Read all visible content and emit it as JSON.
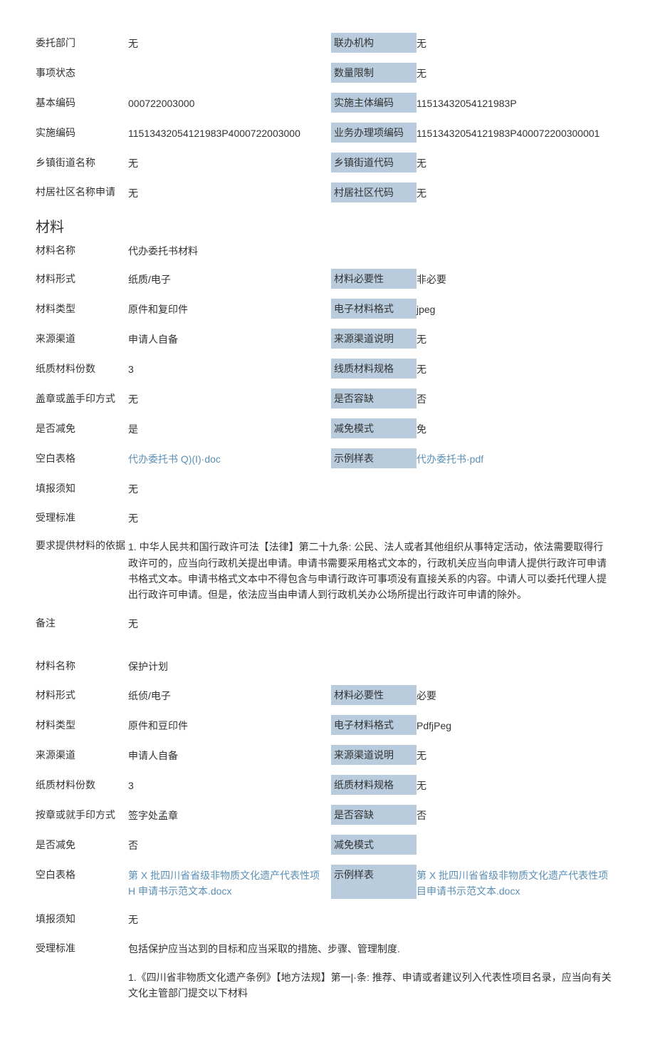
{
  "top": {
    "r1": {
      "l1": "委托部门",
      "v1": "无",
      "l2": "联办机构",
      "v2": "无"
    },
    "r2": {
      "l1": "事项状态",
      "v1": "",
      "l2": "数量限制",
      "v2": "无"
    },
    "r3": {
      "l1": "基本编码",
      "v1": "000722003000",
      "l2": "实施主体编码",
      "v2": "11513432054121983P"
    },
    "r4": {
      "l1": "实施编码",
      "v1": "11513432054121983P4000722003000",
      "l2": "业务办理项编码",
      "v2": "11513432054121983P400072200300001"
    },
    "r5": {
      "l1": "乡镇街道名称",
      "v1": "无",
      "l2": "乡镇街道代码",
      "v2": "无"
    },
    "r6": {
      "l1": "村居社区名称申请",
      "v1": "无",
      "l2": "村居社区代码",
      "v2": "无"
    }
  },
  "section_title": "材料",
  "m1": {
    "name": {
      "label": "材料名称",
      "value": "代办委托书材料"
    },
    "r1": {
      "l1": "材料形式",
      "v1": "纸质/电子",
      "l2": "材料必要性",
      "v2": "非必要"
    },
    "r2": {
      "l1": "材料类型",
      "v1": "原件和复印件",
      "l2": "电子材料格式",
      "v2": "jpeg"
    },
    "r3": {
      "l1": "来源渠道",
      "v1": "申请人自备",
      "l2": "来源渠道说明",
      "v2": "无"
    },
    "r4": {
      "l1": "纸质材料份数",
      "v1": "3",
      "l2": "线质材料规格",
      "v2": "无"
    },
    "r5": {
      "l1": "盖章或盖手印方式",
      "v1": "无",
      "l2": "是否容缺",
      "v2": "否"
    },
    "r6": {
      "l1": "是否减免",
      "v1": "是",
      "l2": "减免模式",
      "v2": "免"
    },
    "r7": {
      "l1": "空白表格",
      "v1": "代办委托书 Q)(I)·doc",
      "l2": "示例样表",
      "v2": "代办委托书·pdf"
    },
    "r8": {
      "l1": "填报须知",
      "v1": "无"
    },
    "r9": {
      "l1": "受理标准",
      "v1": "无"
    },
    "r10": {
      "l1": "要求提供材料的依据",
      "v1": "1. 中华人民共和国行政许可法【法律】第二十九条: 公民、法人或者其他组织从事特定活动，依法需要取得行政许可的，应当向行政机关提出申请。申请书需要采用格式文本的，行政机关应当向申请人提供行政许可申请书格式文本。申请书格式文本中不得包含与申请行政许可事项没有直接关系的内容。中请人可以委托代理人提出行政许可申请。但是，依法应当由申请人到行政机关办公场所提出行政许可申请的除外。"
    },
    "r11": {
      "l1": "备注",
      "v1": "无"
    }
  },
  "m2": {
    "name": {
      "label": "材料名称",
      "value": "保护计划"
    },
    "r1": {
      "l1": "材料形式",
      "v1": "纸侦/电子",
      "l2": "材料必要性",
      "v2": "必要"
    },
    "r2": {
      "l1": "材料类型",
      "v1": "原件和豆印件",
      "l2": "电子材料格式",
      "v2": "PdfjPeg"
    },
    "r3": {
      "l1": "来源渠道",
      "v1": "申请人自备",
      "l2": "来源渠道说明",
      "v2": "无"
    },
    "r4": {
      "l1": "纸质材料份数",
      "v1": "3",
      "l2": "纸质材料规格",
      "v2": "无"
    },
    "r5": {
      "l1": "按章或就手印方式",
      "v1": "签字处孟章",
      "l2": "是否容缺",
      "v2": "否"
    },
    "r6": {
      "l1": "是否减免",
      "v1": "否",
      "l2": "减免模式",
      "v2": ""
    },
    "r7": {
      "l1": "空白表格",
      "v1": "第 X 批四川省省级非物质文化遗产代表性项 H 申请书示范文本.docx",
      "l2": "示例样表",
      "v2": "第 X 批四川省省级非物质文化遗产代表性项目申请书示范文本.docx"
    },
    "r8": {
      "l1": "填报须知",
      "v1": "无"
    },
    "r9": {
      "l1": "受理标准",
      "v1": "包括保护应当达到的目标和应当采取的措施、步骤、管理制度."
    },
    "r10": {
      "l1": "",
      "v1": "1.《四川省非物质文化遗产条例》【地方法规】第一|·条: 推荐、申请或者建议列入代表性项目名录，应当向有关文化主管部门提交以下材料"
    }
  }
}
